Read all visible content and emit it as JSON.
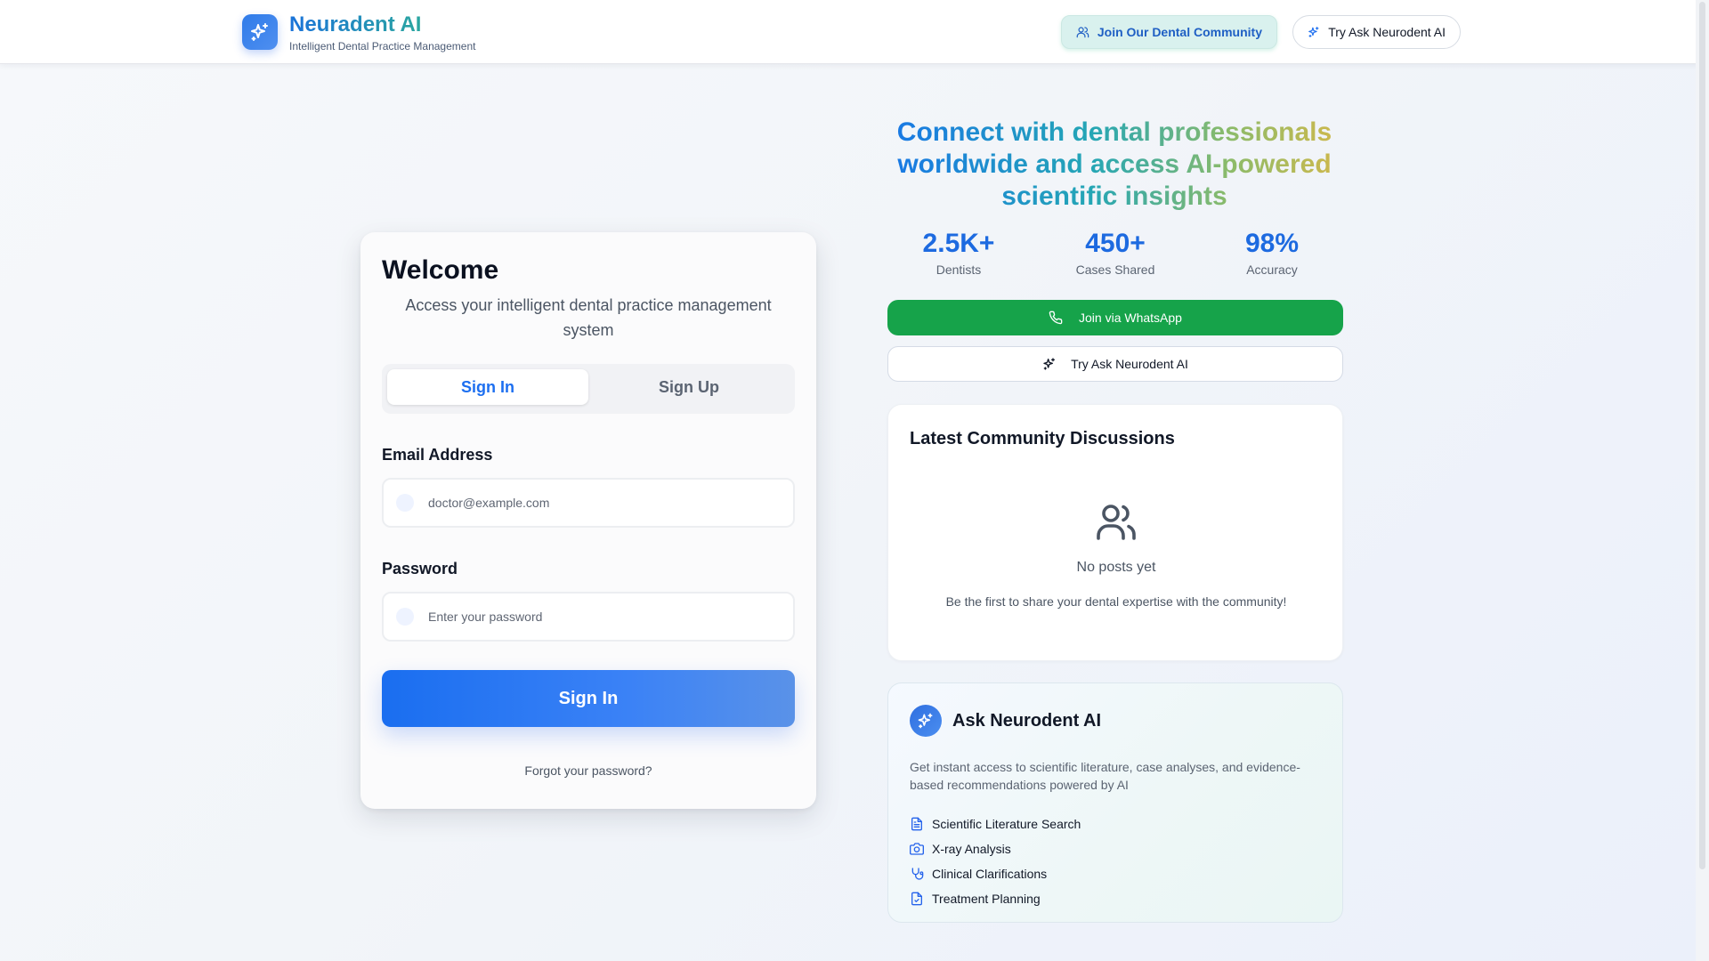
{
  "header": {
    "brand": "Neuradent AI",
    "tagline": "Intelligent Dental Practice Management",
    "community_button": "Join Our Dental Community",
    "ai_button": "Try Ask Neurodent AI"
  },
  "auth": {
    "title": "Welcome",
    "subtitle": "Access your intelligent dental practice management system",
    "tabs": [
      {
        "label": "Sign In",
        "active": true
      },
      {
        "label": "Sign Up",
        "active": false
      }
    ],
    "email": {
      "label": "Email Address",
      "placeholder": "doctor@example.com",
      "value": ""
    },
    "password": {
      "label": "Password",
      "placeholder": "Enter your password",
      "value": ""
    },
    "submit_label": "Sign In",
    "forgot_label": "Forgot your password?"
  },
  "hero": {
    "headline": "Connect with dental professionals worldwide and access AI-powered scientific insights",
    "stats": [
      {
        "value": "2.5K+",
        "label": "Dentists"
      },
      {
        "value": "450+",
        "label": "Cases Shared"
      },
      {
        "value": "98%",
        "label": "Accuracy"
      }
    ],
    "whatsapp_button": "Join via WhatsApp",
    "try_button": "Try Ask Neurodent AI"
  },
  "discussions": {
    "title": "Latest Community Discussions",
    "empty_title": "No posts yet",
    "empty_text": "Be the first to share your dental expertise with the community!"
  },
  "ask": {
    "title": "Ask Neurodent AI",
    "description": "Get instant access to scientific literature, case analyses, and evidence-based recommendations powered by AI",
    "features": [
      {
        "label": "Scientific Literature Search",
        "icon": "document-icon"
      },
      {
        "label": "X-ray Analysis",
        "icon": "camera-icon"
      },
      {
        "label": "Clinical Clarifications",
        "icon": "stethoscope-icon"
      },
      {
        "label": "Treatment Planning",
        "icon": "file-check-icon"
      }
    ]
  },
  "colors": {
    "primary": "#1d6ff0",
    "whatsapp": "#16a34a",
    "accent_teal": "#2aa6a0"
  }
}
